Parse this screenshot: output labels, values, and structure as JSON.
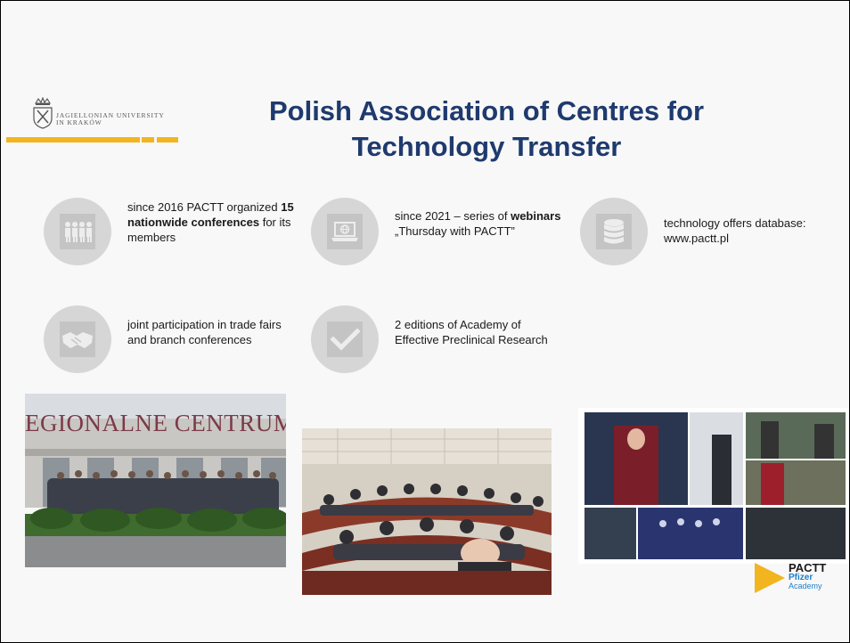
{
  "university": {
    "name_line1": "Jagiellonian University",
    "name_line2": "in Kraków",
    "accent_color": "#f2b51f"
  },
  "title": {
    "line1": "Polish Association of Centres for",
    "line2": "Technology Transfer",
    "color": "#1f3a6e"
  },
  "features": [
    {
      "icon": "people-group-icon",
      "pre": "since 2016 PACTT organized ",
      "bold": "15 nationwide conferences",
      "post": " for its members"
    },
    {
      "icon": "laptop-globe-icon",
      "pre": "since 2021 – series of ",
      "bold": "webinars",
      "post": " „Thursday with PACTT”"
    },
    {
      "icon": "database-icon",
      "pre": "technology offers database: www.pactt.pl",
      "bold": "",
      "post": ""
    },
    {
      "icon": "handshake-icon",
      "pre": "joint participation in trade fairs and branch conferences",
      "bold": "",
      "post": ""
    },
    {
      "icon": "checkmark-icon",
      "pre": "2 editions of Academy of Effective Preclinical Research",
      "bold": "",
      "post": ""
    }
  ],
  "photos": {
    "building_sign": "EGIONALNE CENTRUM INNOWACY"
  },
  "pactt_logo": {
    "main": "PACTT",
    "sub": "Pfizer",
    "sub2": "Academy"
  }
}
